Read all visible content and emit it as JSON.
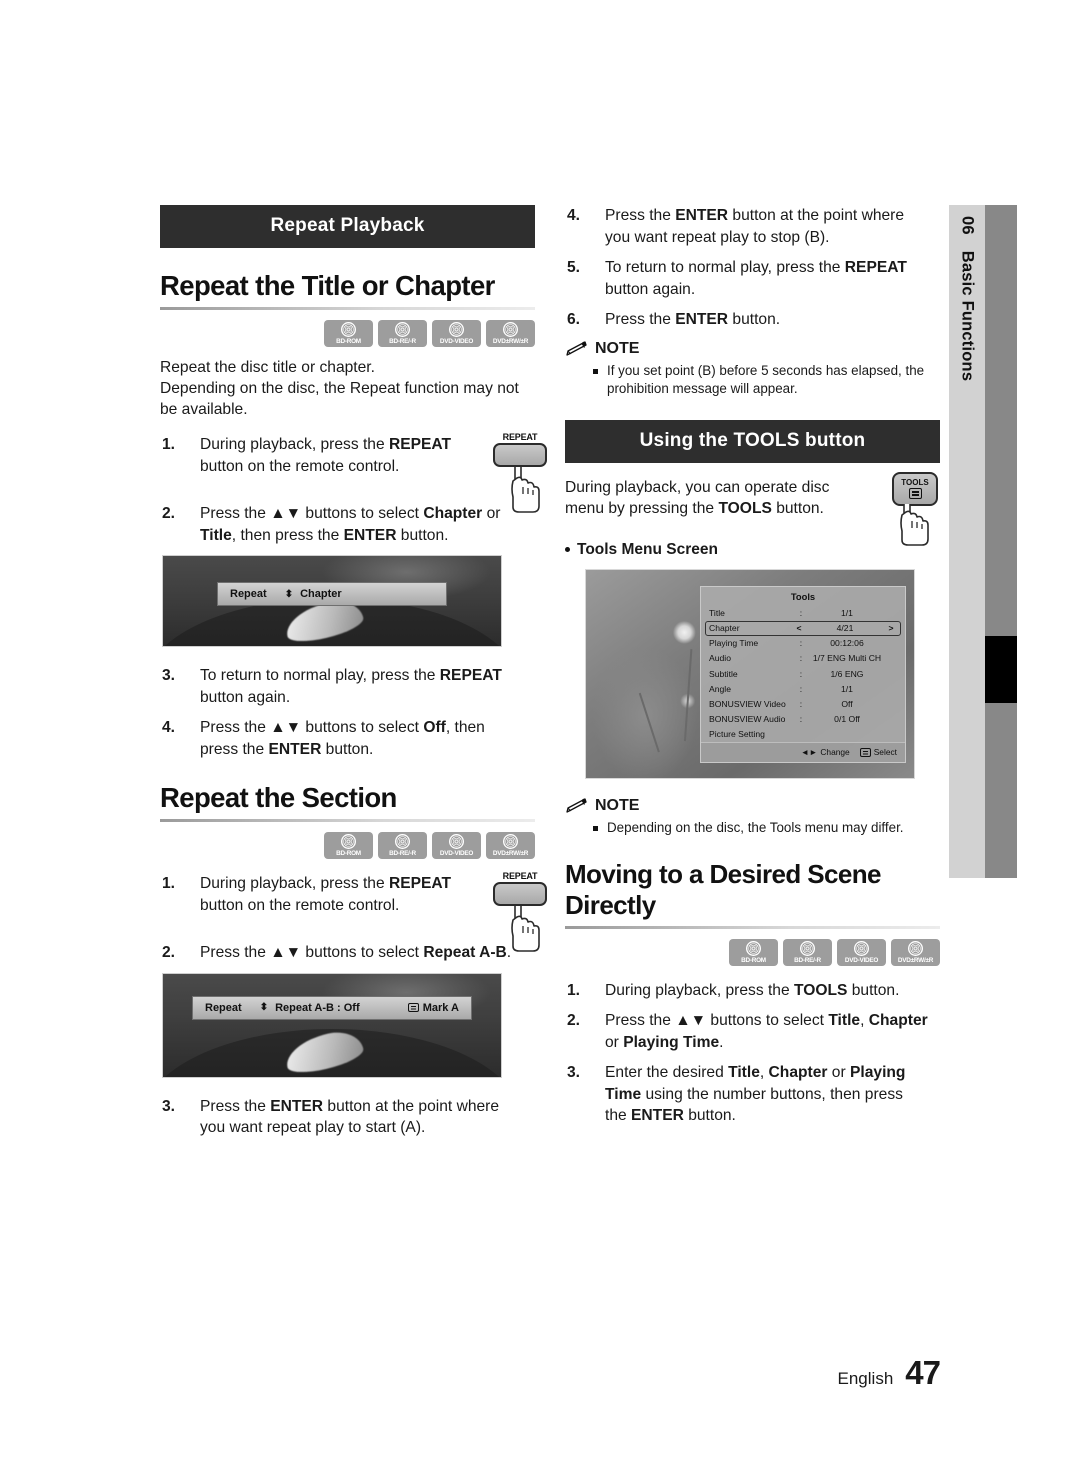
{
  "side_tab": {
    "number": "06",
    "label": "Basic Functions"
  },
  "footer": {
    "language": "English",
    "page": "47"
  },
  "left_column": {
    "banner": "Repeat Playback",
    "section1": {
      "heading": "Repeat the Title or Chapter",
      "discs": [
        "BD-ROM",
        "BD-RE/-R",
        "DVD-VIDEO",
        "DVD±RW/±R"
      ],
      "intro1": "Repeat the disc title or chapter.",
      "intro2": "Depending on the disc, the Repeat function may not be available.",
      "steps": [
        {
          "num": "1.",
          "text": "During playback, press the REPEAT button on the remote control."
        },
        {
          "num": "2.",
          "text": "Press the ▲▼ buttons to select Chapter or Title, then press the ENTER button."
        },
        {
          "num": "3.",
          "text": "To return to normal play, press the REPEAT button again."
        },
        {
          "num": "4.",
          "text": "Press the ▲▼ buttons to select Off, then press the ENTER button."
        }
      ],
      "key": "REPEAT",
      "osd": {
        "label": "Repeat",
        "updown": "⬍",
        "value": "Chapter"
      }
    },
    "section2": {
      "heading": "Repeat the Section",
      "discs": [
        "BD-ROM",
        "BD-RE/-R",
        "DVD-VIDEO",
        "DVD±RW/±R"
      ],
      "steps": [
        {
          "num": "1.",
          "text": "During playback, press the REPEAT button on the remote control."
        },
        {
          "num": "2.",
          "text": "Press the ▲▼ buttons to select Repeat A-B."
        },
        {
          "num": "3.",
          "text": "Press the ENTER button at the point where you want repeat play to start (A)."
        }
      ],
      "key": "REPEAT",
      "osd": {
        "label": "Repeat",
        "updown": "⬍",
        "value": "Repeat A-B : Off",
        "enter_label": "Mark A"
      }
    }
  },
  "right_column": {
    "steps_cont": [
      {
        "num": "4.",
        "text": "Press the ENTER button at the point where you want repeat play to stop (B)."
      },
      {
        "num": "5.",
        "text": "To return to normal play, press the REPEAT button again."
      },
      {
        "num": "6.",
        "text": "Press the ENTER button."
      }
    ],
    "note1": {
      "title": "NOTE",
      "items": [
        "If you set point (B) before 5 seconds has elapsed, the prohibition message will appear."
      ]
    },
    "banner": "Using the TOOLS button",
    "tools_intro": "During playback, you can operate disc menu by pressing the TOOLS button.",
    "tools_key": "TOOLS",
    "tools_menu_caption": "Tools Menu Screen",
    "tools_menu": {
      "title": "Tools",
      "rows": [
        {
          "key": "Title",
          "sep": ":",
          "value": "1/1",
          "selected": false
        },
        {
          "key": "Chapter",
          "sep": "<",
          "value": "4/21",
          "selected": true,
          "right": ">"
        },
        {
          "key": "Playing Time",
          "sep": ":",
          "value": "00:12:06",
          "selected": false
        },
        {
          "key": "Audio",
          "sep": ":",
          "value": "1/7 ENG Multi CH",
          "selected": false
        },
        {
          "key": "Subtitle",
          "sep": ":",
          "value": "1/6 ENG",
          "selected": false
        },
        {
          "key": "Angle",
          "sep": ":",
          "value": "1/1",
          "selected": false
        },
        {
          "key": "BONUSVIEW Video",
          "sep": ":",
          "value": "Off",
          "selected": false
        },
        {
          "key": "BONUSVIEW Audio",
          "sep": ":",
          "value": "0/1 Off",
          "selected": false
        },
        {
          "key": "Picture Setting",
          "sep": "",
          "value": "",
          "selected": false
        }
      ],
      "footer": {
        "change": "Change",
        "change_arrows": "◄►",
        "select": "Select"
      }
    },
    "note2": {
      "title": "NOTE",
      "items": [
        "Depending on the disc, the Tools menu may differ."
      ]
    },
    "section3": {
      "heading": "Moving to a Desired Scene Directly",
      "discs": [
        "BD-ROM",
        "BD-RE/-R",
        "DVD-VIDEO",
        "DVD±RW/±R"
      ],
      "steps": [
        {
          "num": "1.",
          "text": "During playback, press the TOOLS button."
        },
        {
          "num": "2.",
          "text": "Press the ▲▼ buttons to select Title, Chapter or Playing Time."
        },
        {
          "num": "3.",
          "text": "Enter the desired Title, Chapter or Playing Time using the number buttons, then press the ENTER button."
        }
      ]
    }
  }
}
